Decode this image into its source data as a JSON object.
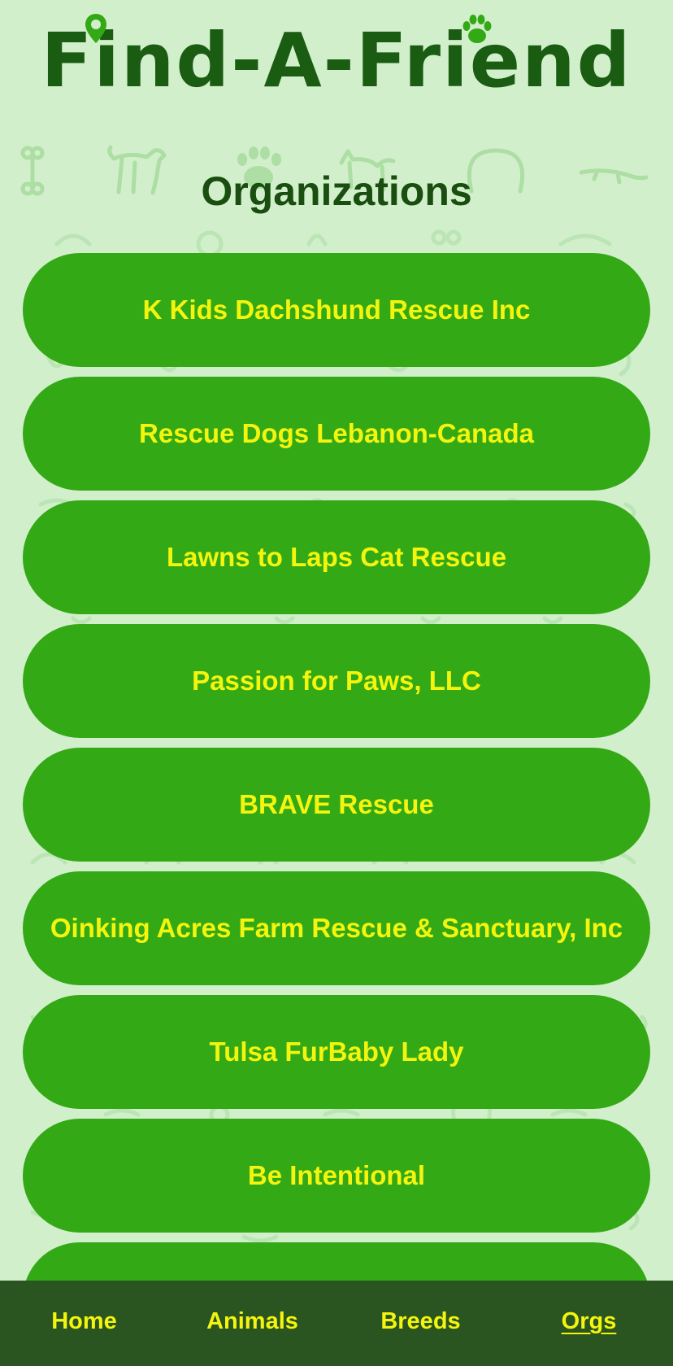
{
  "app": {
    "logo_text": "Find-A-Friend"
  },
  "page": {
    "title": "Organizations"
  },
  "organizations": [
    "K Kids Dachshund Rescue Inc",
    "Rescue Dogs Lebanon-Canada",
    "Lawns to Laps Cat Rescue",
    "Passion for Paws, LLC",
    "BRAVE Rescue",
    "Oinking Acres Farm Rescue & Sanctuary, Inc",
    "Tulsa FurBaby Lady",
    "Be Intentional",
    ""
  ],
  "tabbar": {
    "tabs": [
      {
        "label": "Home",
        "active": false
      },
      {
        "label": "Animals",
        "active": false
      },
      {
        "label": "Breeds",
        "active": false
      },
      {
        "label": "Orgs",
        "active": true
      }
    ]
  },
  "colors": {
    "background": "#d2efcc",
    "logo": "#1a5c12",
    "title": "#1a4d10",
    "button": "#33a915",
    "button_text": "#f3f50f",
    "tabbar": "#2a5420",
    "tab_text": "#f3f50f"
  },
  "icons": {
    "logo_pin": "map-pin-icon",
    "logo_paw": "paw-icon"
  }
}
